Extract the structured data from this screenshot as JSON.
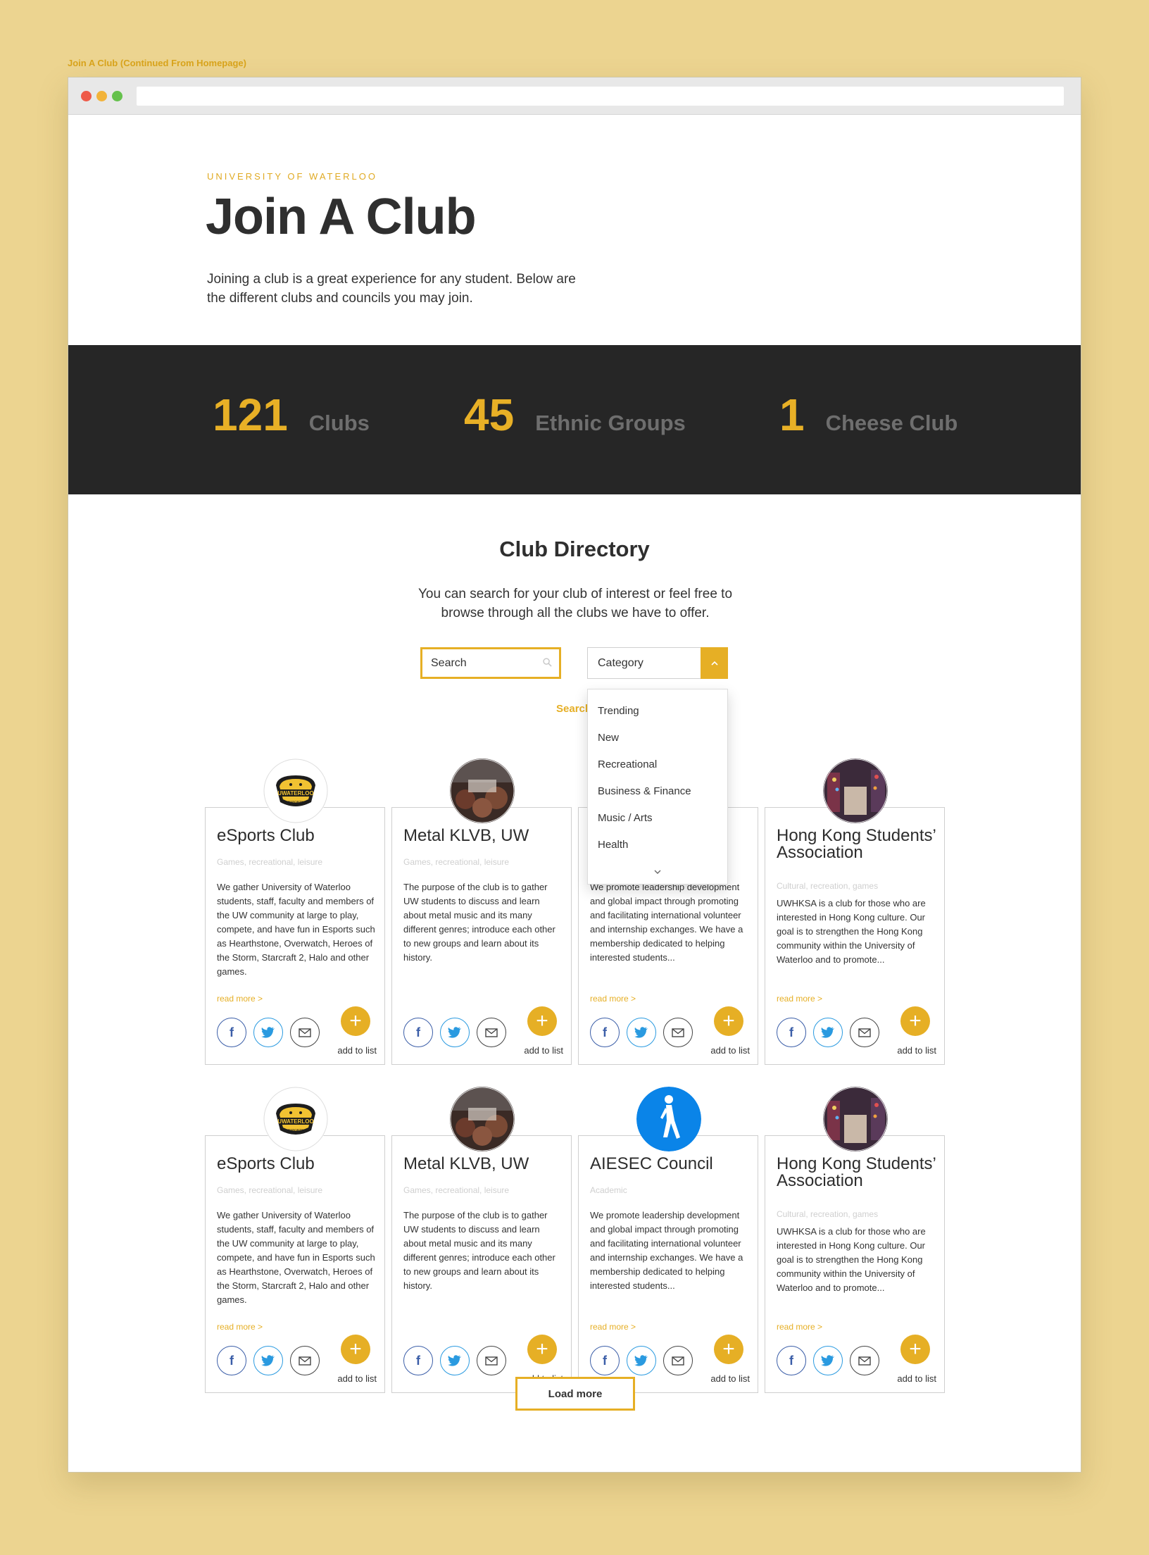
{
  "caption": "Join A Club  (Continued From Homepage)",
  "hero": {
    "eyebrow": "UNIVERSITY OF WATERLOO",
    "title": "Join A Club",
    "intro": "Joining a club is a great experience for any student. Below are the different clubs and councils you may join."
  },
  "stats": [
    {
      "number": "121",
      "label": "Clubs"
    },
    {
      "number": "45",
      "label": "Ethnic Groups"
    },
    {
      "number": "1",
      "label": "Cheese Club"
    }
  ],
  "directory": {
    "title": "Club Directory",
    "subtitle": "You can search for your club of interest or feel free to browse through all the clubs we have to offer.",
    "search_placeholder": "Search",
    "category_label": "Category",
    "search_link": "Search",
    "dropdown_options": [
      "Trending",
      "New",
      "Recreational",
      "Business & Finance",
      "Music / Arts",
      "Health"
    ],
    "load_more": "Load more"
  },
  "cards": [
    {
      "name": "eSports Club",
      "tags": "Games, recreational, leisure",
      "description": "We gather University of Waterloo students, staff, faculty and members of the UW community at large to play, compete, and have fun in Esports such as Hearthstone, Overwatch, Heroes of the Storm, Starcraft 2, Halo and other games.",
      "read_more": "read more >",
      "add_label": "add to list",
      "avatar": "esports-logo"
    },
    {
      "name": "Metal KLVB, UW",
      "tags": "Games, recreational, leisure",
      "description": "The purpose of the club is to gather UW students to discuss and learn about metal music and its many different genres; introduce each other to new groups and learn about its history.",
      "read_more": "",
      "add_label": "add to list",
      "avatar": "metal-photo"
    },
    {
      "name": "AIESEC Council",
      "tags": "Academic",
      "description": "We promote leadership development and global impact through promoting and facilitating international volunteer and internship exchanges. We have a membership dedicated to helping interested students...",
      "read_more": "read more >",
      "add_label": "add to list",
      "avatar": "walker-icon"
    },
    {
      "name": "Hong Kong Students’ Association",
      "tags": "Cultural, recreation, games",
      "description": "UWHKSA is a club for those who are interested in Hong Kong culture. Our goal is to strengthen the Hong Kong community within the University of Waterloo and to promote...",
      "read_more": "read more >",
      "add_label": "add to list",
      "avatar": "city-photo"
    },
    {
      "name": "eSports Club",
      "tags": "Games, recreational, leisure",
      "description": "We gather University of Waterloo students, staff, faculty and members of the UW community at large to play, compete, and have fun in Esports such as Hearthstone, Overwatch, Heroes of the Storm, Starcraft 2, Halo and other games.",
      "read_more": "read more >",
      "add_label": "add to list",
      "avatar": "esports-logo"
    },
    {
      "name": "Metal KLVB, UW",
      "tags": "Games, recreational, leisure",
      "description": "The purpose of the club is to gather UW students to discuss and learn about metal music and its many different genres; introduce each other to new groups and learn about its history.",
      "read_more": "",
      "add_label": "add to list",
      "avatar": "metal-photo"
    },
    {
      "name": "AIESEC Council",
      "tags": "Academic",
      "description": "We promote leadership development and global impact through promoting and facilitating international volunteer and internship exchanges. We have a membership dedicated to helping interested students...",
      "read_more": "read more >",
      "add_label": "add to list",
      "avatar": "walker-icon"
    },
    {
      "name": "Hong Kong Students’ Association",
      "tags": "Cultural, recreation, games",
      "description": "UWHKSA is a club for those who are interested in Hong Kong culture. Our goal is to strengthen the Hong Kong community within the University of Waterloo and to promote...",
      "read_more": "read more >",
      "add_label": "add to list",
      "avatar": "city-photo"
    }
  ],
  "logo_text": {
    "esports_top": "UWATERLOO",
    "esports_bottom": "ESPORTS"
  },
  "colors": {
    "accent": "#e6af25",
    "dark_band": "#262626",
    "background": "#ecd490",
    "facebook": "#3b5ea8",
    "twitter": "#2a9ae0",
    "aiesec_blue": "#0a84e8"
  }
}
